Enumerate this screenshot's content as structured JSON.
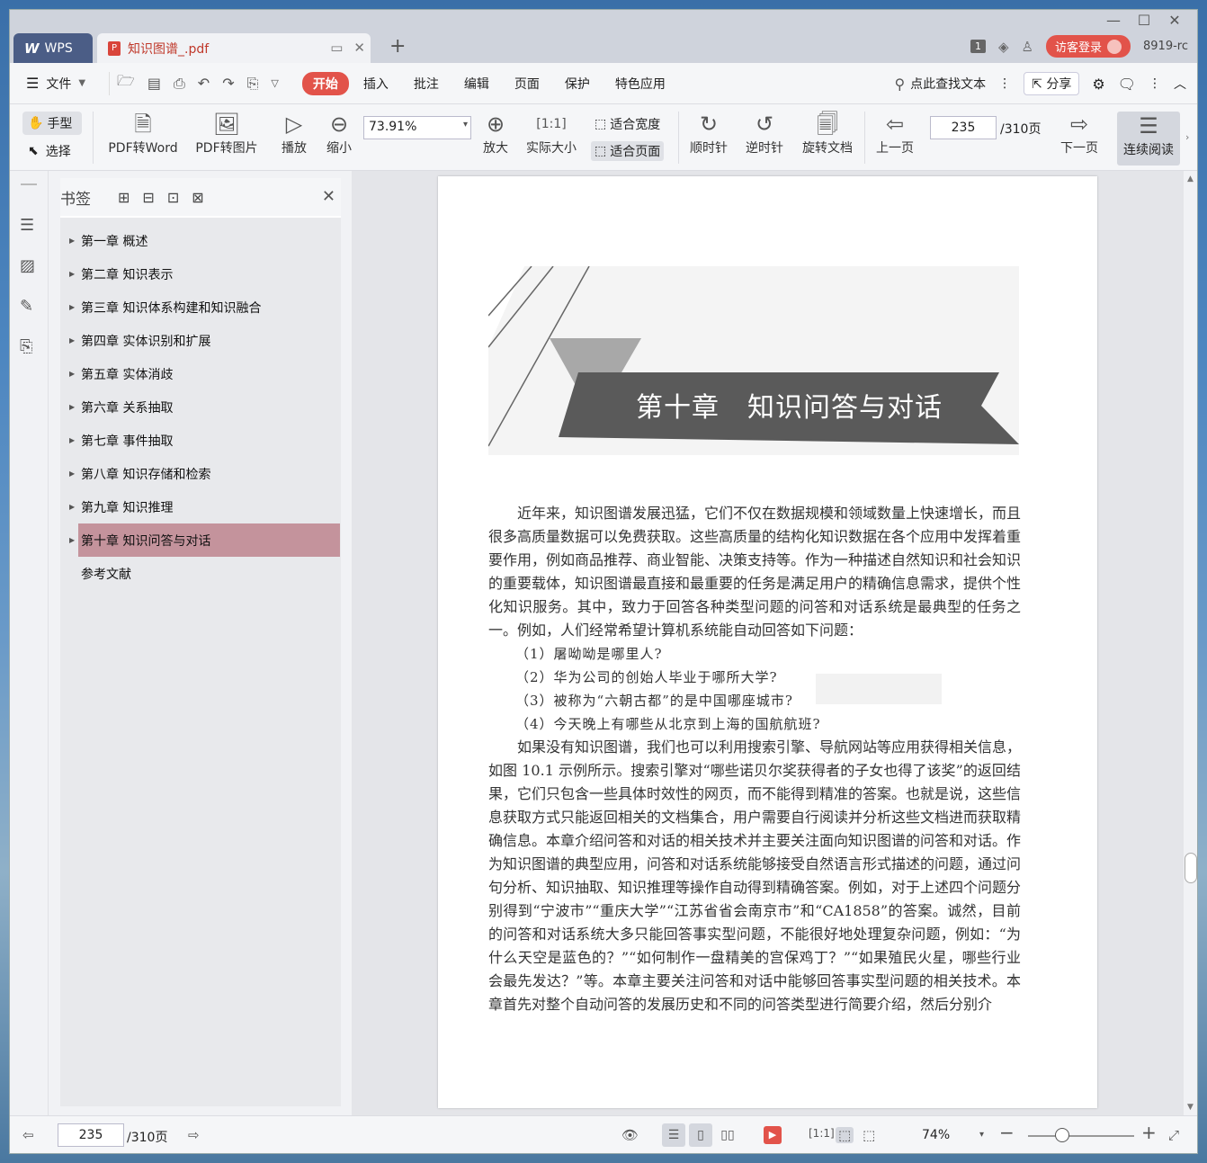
{
  "titlebar": {
    "app_tab": "WPS",
    "doc_tab": "知识图谱_.pdf",
    "page_badge": "1",
    "login": "访客登录",
    "version": "8919-rc"
  },
  "menubar": {
    "file": "文件",
    "tabs": [
      "开始",
      "插入",
      "批注",
      "编辑",
      "页面",
      "保护",
      "特色应用"
    ],
    "active_tab": "开始",
    "find": "点此查找文本",
    "share": "分享"
  },
  "toolbar": {
    "hand": "手型",
    "select": "选择",
    "pdf_to_word": "PDF转Word",
    "pdf_to_image": "PDF转图片",
    "play": "播放",
    "zoom_out": "缩小",
    "zoom_value": "73.91%",
    "zoom_in": "放大",
    "actual_size": "实际大小",
    "fit_width": "适合宽度",
    "fit_page": "适合页面",
    "clockwise": "顺时针",
    "counterclockwise": "逆时针",
    "rotate_doc": "旋转文档",
    "prev_page": "上一页",
    "current_page": "235",
    "total_pages": "/310页",
    "next_page": "下一页",
    "continuous": "连续阅读"
  },
  "bookmarks": {
    "title": "书签",
    "items": [
      {
        "label": "第一章 概述",
        "expandable": true
      },
      {
        "label": "第二章 知识表示",
        "expandable": true
      },
      {
        "label": "第三章 知识体系构建和知识融合",
        "expandable": true
      },
      {
        "label": "第四章 实体识别和扩展",
        "expandable": true
      },
      {
        "label": "第五章 实体消歧",
        "expandable": true
      },
      {
        "label": "第六章 关系抽取",
        "expandable": true
      },
      {
        "label": "第七章 事件抽取",
        "expandable": true
      },
      {
        "label": "第八章 知识存储和检索",
        "expandable": true
      },
      {
        "label": "第九章 知识推理",
        "expandable": true
      },
      {
        "label": "第十章 知识问答与对话",
        "expandable": true,
        "selected": true
      },
      {
        "label": "参考文献",
        "expandable": false
      }
    ]
  },
  "document": {
    "chapter_title": "第十章　知识问答与对话",
    "paragraph1": "近年来，知识图谱发展迅猛，它们不仅在数据规模和领域数量上快速增长，而且很多高质量数据可以免费获取。这些高质量的结构化知识数据在各个应用中发挥着重要作用，例如商品推荐、商业智能、决策支持等。作为一种描述自然知识和社会知识的重要载体，知识图谱最直接和最重要的任务是满足用户的精确信息需求，提供个性化知识服务。其中，致力于回答各种类型问题的问答和对话系统是最典型的任务之一。例如，人们经常希望计算机系统能自动回答如下问题：",
    "questions": [
      "（1）屠呦呦是哪里人?",
      "（2）华为公司的创始人毕业于哪所大学?",
      "（3）被称为“六朝古都”的是中国哪座城市?",
      "（4）今天晚上有哪些从北京到上海的国航航班?"
    ],
    "paragraph2": "如果没有知识图谱，我们也可以利用搜索引擎、导航网站等应用获得相关信息，如图 10.1 示例所示。搜索引擎对“哪些诺贝尔奖获得者的子女也得了该奖”的返回结果，它们只包含一些具体时效性的网页，而不能得到精准的答案。也就是说，这些信息获取方式只能返回相关的文档集合，用户需要自行阅读并分析这些文档进而获取精确信息。本章介绍问答和对话的相关技术并主要关注面向知识图谱的问答和对话。作为知识图谱的典型应用，问答和对话系统能够接受自然语言形式描述的问题，通过问句分析、知识抽取、知识推理等操作自动得到精确答案。例如，对于上述四个问题分别得到“宁波市”“重庆大学”“江苏省省会南京市”和“CA1858”的答案。诚然，目前的问答和对话系统大多只能回答事实型问题，不能很好地处理复杂问题，例如：“为什么天空是蓝色的？”“如何制作一盘精美的宫保鸡丁？”“如果殖民火星，哪些行业会最先发达？”等。本章主要关注问答和对话中能够回答事实型问题的相关技术。本章首先对整个自动问答的发展历史和不同的问答类型进行简要介绍，然后分别介"
  },
  "statusbar": {
    "current_page": "235",
    "total_pages": "/310页",
    "zoom": "74%",
    "zoom_fraction": 0.4
  },
  "colors": {
    "accent": "#e2534a",
    "bookmark_selected": "#c4939c",
    "wps_tab": "#4b5d86"
  }
}
